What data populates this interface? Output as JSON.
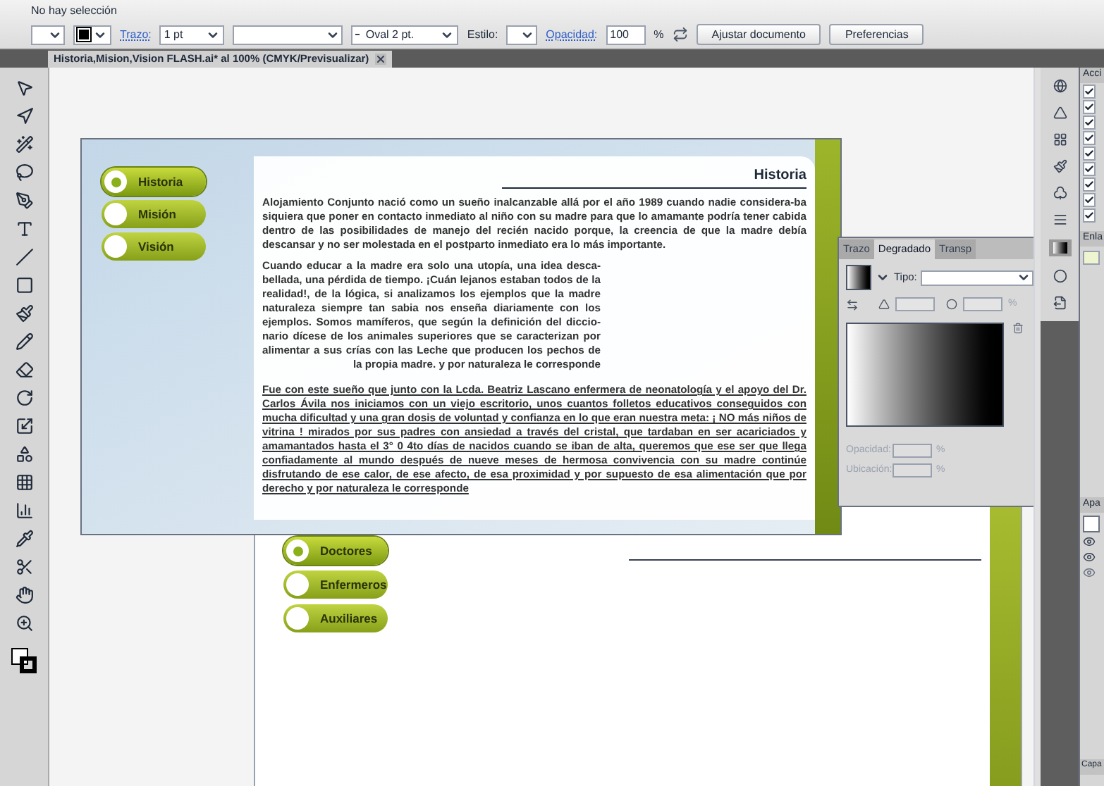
{
  "control_bar": {
    "selection": "No hay selección",
    "stroke_label": "Trazo:",
    "stroke_weight": "1 pt",
    "brush": "Oval 2 pt.",
    "style_label": "Estilo:",
    "opacity_label": "Opacidad:",
    "opacity_value": "100",
    "opacity_unit": "%",
    "buttons": [
      "Ajustar documento",
      "Preferencias"
    ]
  },
  "document_tab": {
    "title": "Historia,Mision,Vision FLASH.ai* al 100% (CMYK/Previsualizar)"
  },
  "artboard_1": {
    "nav": [
      {
        "label": "Historia",
        "selected": true
      },
      {
        "label": "Misión",
        "selected": false
      },
      {
        "label": "Visión",
        "selected": false
      }
    ],
    "heading": "Historia",
    "paragraphs": [
      "Alojamiento Conjunto nació como un sueño inalcanzable allá por el año 1989 cuando nadie considera-ba siquiera que poner en contacto inmediato al niño con su madre para que lo amamante podría tener cabida dentro de las posibilidades de manejo del recién nacido porque, la creencia de que la madre debía descansar y no ser molestada en el postparto inmediato era lo más importante.",
      "Cuando educar a la madre era solo una utopía, una idea desca-bellada, una pérdida de tiempo. ¡Cuán lejanos estaban todos de la realidad!, de la lógica, si analizamos los ejemplos que la madre naturaleza siempre tan sabia nos enseña diariamente con los ejemplos. Somos mamíferos, que según la definición del diccio-nario dícese de los animales superiores que se caracterizan por alimentar a sus crías con las Leche que producen los pechos de la propia madre. y por naturaleza le corresponde",
      "Fue con este sueño que junto con la Lcda. Beatriz Lascano enfermera de neonatología y el apoyo del Dr. Carlos Ávila nos iniciamos con un viejo escritorio, unos cuantos folletos educativos conseguidos con mucha dificultad y una gran dosis de voluntad y confianza en lo que eran nuestra meta: ¡ NO más niños de vitrina ! mirados por sus padres con ansiedad a través del cristal, que tardaban en ser acariciados y amamantados hasta el 3° 0 4to días de nacidos cuando se iban de alta, queremos que ese ser que llega confiadamente al mundo después de nueve meses de hermosa convivencia con su madre continúe disfrutando de ese calor, de ese afecto, de esa proximidad y por supuesto de esa alimentación que por derecho y por naturaleza le corresponde"
    ]
  },
  "artboard_2": {
    "nav": [
      {
        "label": "Doctores",
        "selected": true
      },
      {
        "label": "Enfermeros",
        "selected": false
      },
      {
        "label": "Auxiliares",
        "selected": false
      }
    ]
  },
  "gradient_panel": {
    "tabs": [
      {
        "label": "Trazo",
        "selected": false
      },
      {
        "label": "Degradado",
        "selected": true
      },
      {
        "label": "Transp",
        "selected": false
      }
    ],
    "type_label": "Tipo:",
    "aspect_unit": "%",
    "opacity_label": "Opacidad:",
    "opacity_unit": "%",
    "location_label": "Ubicación:",
    "location_unit": "%"
  },
  "right_panels": {
    "actions": {
      "title": "Acci",
      "items": [
        {
          "checked": true
        },
        {
          "checked": true
        },
        {
          "checked": true
        },
        {
          "checked": true
        },
        {
          "checked": true
        },
        {
          "checked": true
        },
        {
          "checked": true
        },
        {
          "checked": true
        },
        {
          "checked": true
        }
      ]
    },
    "links": {
      "title": "Enla"
    },
    "appearance": {
      "title": "Apa"
    },
    "layers": {
      "title": "Capa"
    }
  }
}
